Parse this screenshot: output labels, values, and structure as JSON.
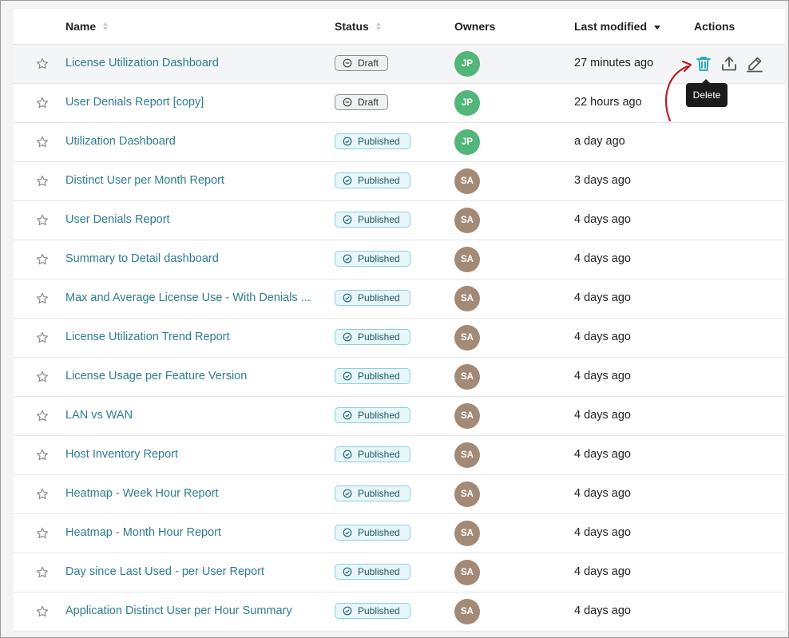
{
  "header": {
    "name": "Name",
    "status": "Status",
    "owners": "Owners",
    "last_modified": "Last modified",
    "actions": "Actions"
  },
  "tooltip": "Delete",
  "colors": {
    "link": "#2f7d8f",
    "delete_accent": "#1aa0b8",
    "annotation_arrow": "#b3202a",
    "owner_jp": "#52b57a",
    "owner_sa": "#a38a76"
  },
  "rows": [
    {
      "name": "License Utilization Dashboard",
      "status": "Draft",
      "owner": "JP",
      "modified": "27 minutes ago"
    },
    {
      "name": "User Denials Report [copy]",
      "status": "Draft",
      "owner": "JP",
      "modified": "22 hours ago"
    },
    {
      "name": "Utilization Dashboard",
      "status": "Published",
      "owner": "JP",
      "modified": "a day ago"
    },
    {
      "name": "Distinct User per Month Report",
      "status": "Published",
      "owner": "SA",
      "modified": "3 days ago"
    },
    {
      "name": "User Denials Report",
      "status": "Published",
      "owner": "SA",
      "modified": "4 days ago"
    },
    {
      "name": "Summary to Detail dashboard",
      "status": "Published",
      "owner": "SA",
      "modified": "4 days ago"
    },
    {
      "name": "Max and Average License Use - With Denials ...",
      "status": "Published",
      "owner": "SA",
      "modified": "4 days ago"
    },
    {
      "name": "License Utilization Trend Report",
      "status": "Published",
      "owner": "SA",
      "modified": "4 days ago"
    },
    {
      "name": "License Usage per Feature Version",
      "status": "Published",
      "owner": "SA",
      "modified": "4 days ago"
    },
    {
      "name": "LAN vs WAN",
      "status": "Published",
      "owner": "SA",
      "modified": "4 days ago"
    },
    {
      "name": "Host Inventory Report",
      "status": "Published",
      "owner": "SA",
      "modified": "4 days ago"
    },
    {
      "name": "Heatmap - Week Hour Report",
      "status": "Published",
      "owner": "SA",
      "modified": "4 days ago"
    },
    {
      "name": "Heatmap - Month Hour Report",
      "status": "Published",
      "owner": "SA",
      "modified": "4 days ago"
    },
    {
      "name": "Day since Last Used - per User Report",
      "status": "Published",
      "owner": "SA",
      "modified": "4 days ago"
    },
    {
      "name": "Application Distinct User per Hour Summary",
      "status": "Published",
      "owner": "SA",
      "modified": "4 days ago"
    }
  ]
}
